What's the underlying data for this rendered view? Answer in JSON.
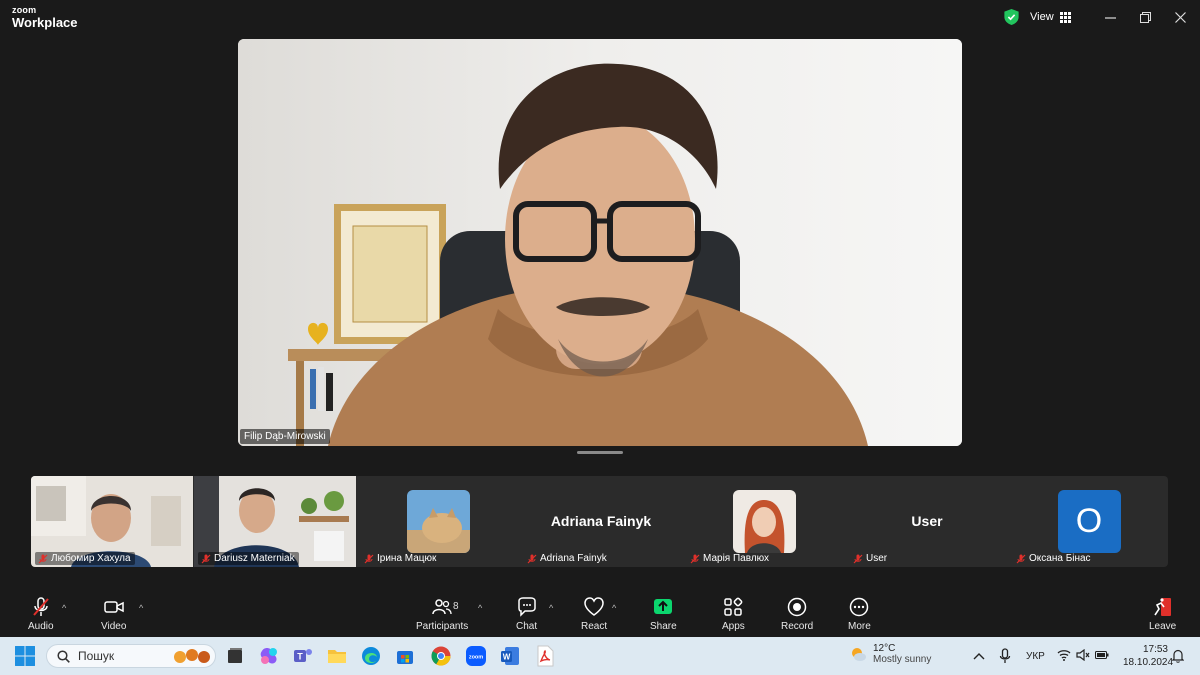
{
  "app": {
    "brand_top": "zoom",
    "brand_bottom": "Workplace"
  },
  "topbar": {
    "view_label": "View"
  },
  "main_video": {
    "participant_name": "Filip Dąb-Mirowski"
  },
  "gallery": [
    {
      "name": "Любомир Хахула",
      "kind": "video",
      "muted": true
    },
    {
      "name": "Dariusz Materniak",
      "kind": "video",
      "muted": true
    },
    {
      "name": "Ірина Мацюк",
      "kind": "avatar-photo",
      "muted": true
    },
    {
      "name": "Adriana Fainyk",
      "kind": "name-only",
      "display": "Adriana Fainyk",
      "muted": true
    },
    {
      "name": "Марія Павлюх",
      "kind": "avatar-photo",
      "muted": true
    },
    {
      "name": "User",
      "kind": "name-only",
      "display": "User",
      "muted": true
    },
    {
      "name": "Оксана Бінас",
      "kind": "avatar-letter",
      "letter": "O",
      "avatar_color": "#1a6dc4",
      "muted": true
    }
  ],
  "toolbar": {
    "audio": "Audio",
    "video": "Video",
    "participants": "Participants",
    "participants_count": "8",
    "chat": "Chat",
    "react": "React",
    "share": "Share",
    "apps": "Apps",
    "record": "Record",
    "more": "More",
    "leave": "Leave"
  },
  "taskbar": {
    "search_placeholder": "Пошук",
    "weather_temp": "12°C",
    "weather_desc": "Mostly sunny",
    "language": "УКР",
    "time": "17:53",
    "date": "18.10.2024"
  },
  "colors": {
    "share_green": "#0bd66e",
    "mute_red": "#e0302b",
    "zoom_blue": "#0b5cff"
  }
}
